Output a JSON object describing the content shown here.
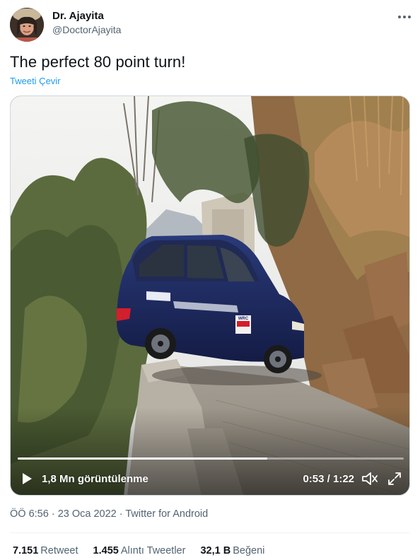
{
  "author": {
    "display_name": "Dr. Ajayita",
    "handle": "@DoctorAjayita",
    "avatar_icon": "profile-photo"
  },
  "more_icon": "ellipsis-horizontal-icon",
  "tweet": {
    "text": "The perfect 80 point turn!",
    "translate_label": "Tweeti Çevir"
  },
  "video": {
    "views_label": "1,8 Mn görüntülenme",
    "time_label": "0:53 / 1:22",
    "progress_fraction": 0.646,
    "icons": [
      "play-icon",
      "volume-icon",
      "fullscreen-icon"
    ],
    "car_plate_text": "WRC"
  },
  "meta": {
    "timestamp": "ÖÖ 6:56 · 23 Oca 2022 · Twitter for Android"
  },
  "stats": {
    "retweets_count": "7.151",
    "retweets_label": "Retweet",
    "quotes_count": "1.455",
    "quotes_label": "Alıntı Tweetler",
    "likes_count": "32,1 B",
    "likes_label": "Beğeni"
  },
  "colors": {
    "link": "#1d9bf0",
    "secondary_text": "#536471",
    "primary_text": "#0f1419"
  }
}
